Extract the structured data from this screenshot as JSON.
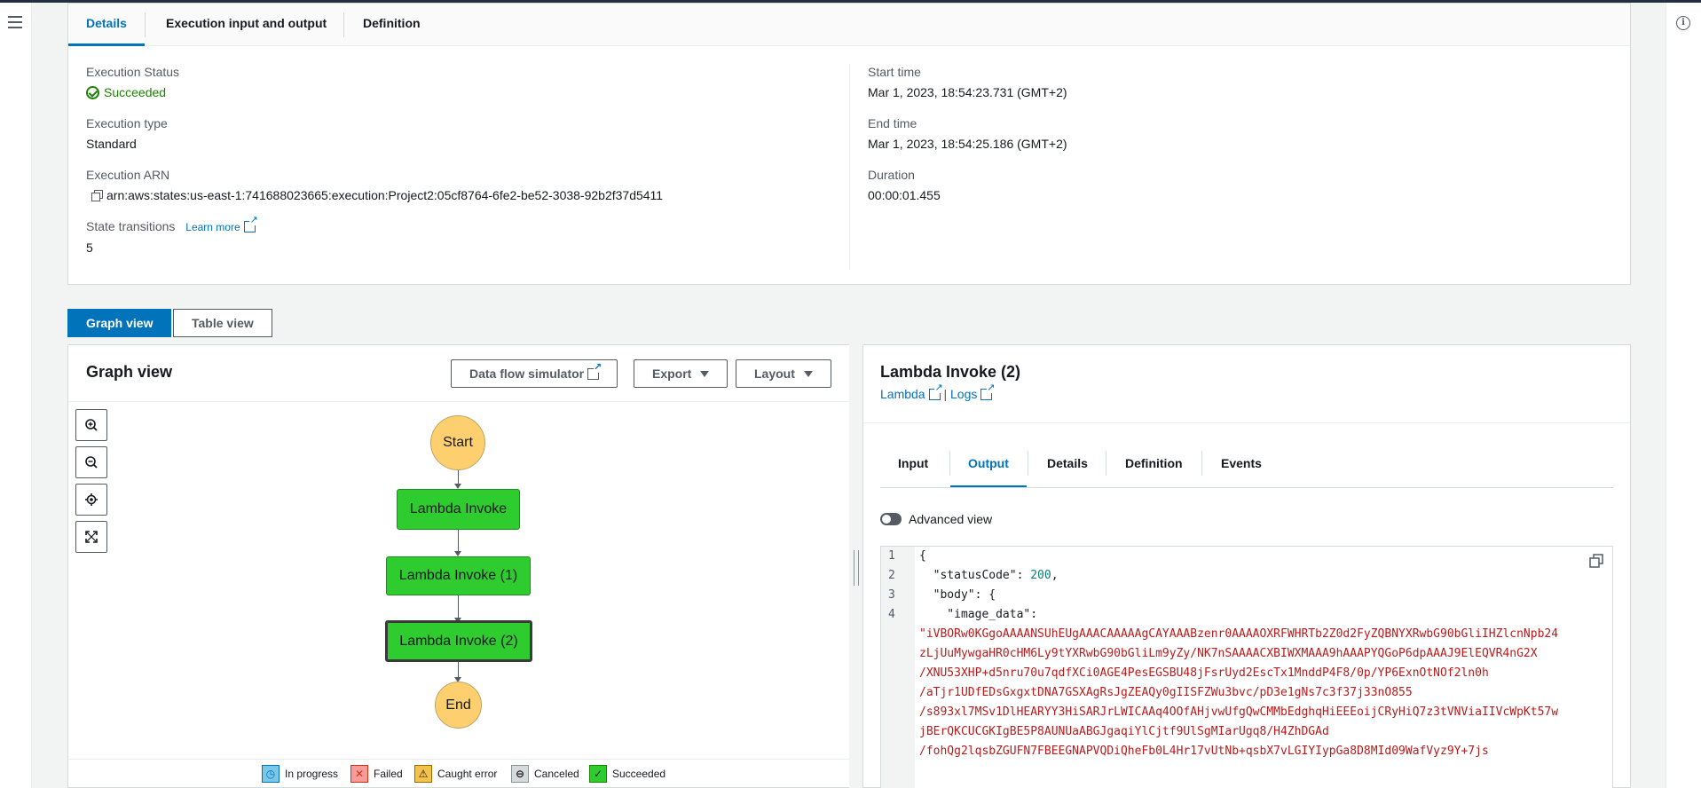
{
  "tabs": [
    "Details",
    "Execution input and output",
    "Definition"
  ],
  "details": {
    "status_label": "Execution Status",
    "status_value": "Succeeded",
    "type_label": "Execution type",
    "type_value": "Standard",
    "arn_label": "Execution ARN",
    "arn_value": "arn:aws:states:us-east-1:741688023665:execution:Project2:05cf8764-6fe2-be52-3038-92b2f37d5411",
    "transitions_label": "State transitions",
    "learn_more": "Learn more",
    "transitions_value": "5",
    "start_label": "Start time",
    "start_value": "Mar 1, 2023, 18:54:23.731 (GMT+2)",
    "end_label": "End time",
    "end_value": "Mar 1, 2023, 18:54:25.186 (GMT+2)",
    "duration_label": "Duration",
    "duration_value": "00:00:01.455"
  },
  "view_toggle": {
    "graph": "Graph view",
    "table": "Table view"
  },
  "graph": {
    "title": "Graph view",
    "simulator_btn": "Data flow simulator",
    "export_btn": "Export",
    "layout_btn": "Layout",
    "controls": [
      "zoom-in-icon",
      "zoom-out-icon",
      "center-icon",
      "fit-icon"
    ],
    "nodes": {
      "start": "Start",
      "n1": "Lambda Invoke",
      "n2": "Lambda Invoke (1)",
      "n3": "Lambda Invoke (2)",
      "end": "End"
    },
    "legend": {
      "in_progress": "In progress",
      "failed": "Failed",
      "caught": "Caught error",
      "canceled": "Canceled",
      "succeeded": "Succeeded"
    },
    "colors": {
      "task_succeeded": "#2ecc2e",
      "terminal": "#fecf6e"
    }
  },
  "output": {
    "title": "Lambda Invoke (2)",
    "lambda_link": "Lambda",
    "sep": " | ",
    "logs_link": "Logs",
    "tabs": [
      "Input",
      "Output",
      "Details",
      "Definition",
      "Events"
    ],
    "advanced_view": "Advanced view",
    "gutter": [
      "1",
      "2",
      "3",
      "4",
      "",
      "",
      "",
      "",
      "",
      "",
      "",
      ""
    ],
    "code_line1": "{",
    "code_key2": "  \"statusCode\"",
    "code_val2": "200",
    "code_key3": "  \"body\"",
    "code_key4": "    \"image_data\"",
    "code_str": [
      "\"iVBORw0KGgoAAAANSUhEUgAAACAAAAAgCAYAAABzenr0AAAAOXRFWHRTb2Z0d2FyZQBNYXRwbG90bGliIHZlcnNpb24",
      "zLjUuMywgaHR0cHM6Ly9tYXRwbG90bGliLm9yZy/NK7nSAAAACXBIWXMAAA9hAAAPYQGoP6dpAAAJ9ElEQVR4nG2X",
      "/XNU53XHP+d5nru70u7qdfXCi0AGE4PesEGSBU48jFsrUyd2EscTx1MnddP4F8/0p/YP6ExnOtNOf2ln0h",
      "/aTjr1UDfEDsGxgxtDNA7GSXAgRsJgZEAQy0gIISFZWu3bvc/pD3e1gNs7c3f37j33nO855",
      "/s893xl7MSv1DlHEARYY3HiSARJrLWICAAq4OOfAHjvwUfgQwCMMbEdghqHiEEEoijCRyHiQ7z3tVNViaIIVcWpKt57w",
      "jBErQKCUCGKIgBE5P8AUNUaABGJgaqiYlCjtf9UlSgMIarUgq8/H4ZhDGAd",
      "/fohQg2lqsbZGUFN7FBEEGNAPVQDiQheFb0L4Hr17vUtNb+qsbX7vLGIYIypGa8D8MId09WafVyz9Y+7js"
    ]
  }
}
